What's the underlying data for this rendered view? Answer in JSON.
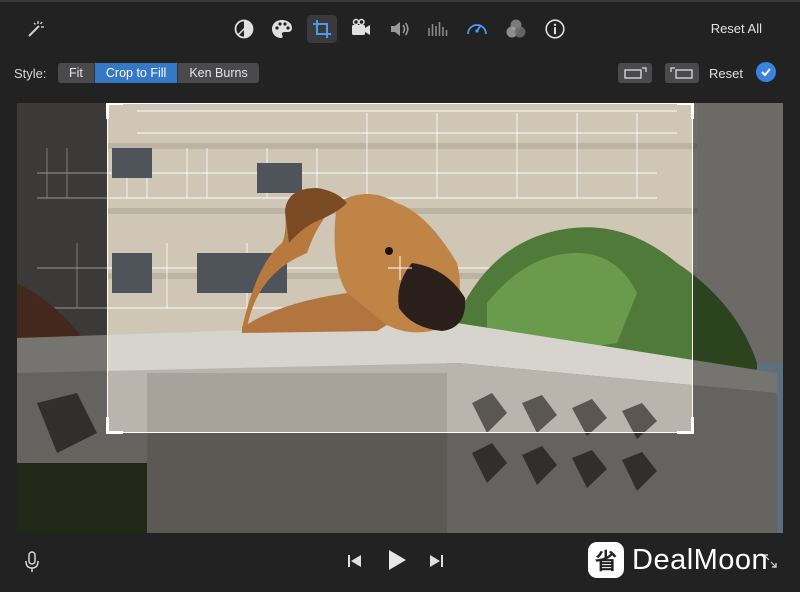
{
  "toolbar": {
    "icons": [
      "magic-wand-icon",
      "color-balance-icon",
      "color-palette-icon",
      "crop-icon",
      "stabilization-icon",
      "volume-icon",
      "equalizer-icon",
      "speed-icon",
      "filter-icon",
      "info-icon"
    ],
    "reset_all_label": "Reset All"
  },
  "style_bar": {
    "label": "Style:",
    "options": [
      "Fit",
      "Crop to Fill",
      "Ken Burns"
    ],
    "selected": "Crop to Fill",
    "reset_label": "Reset"
  },
  "playback": {
    "icons": [
      "microphone-icon",
      "skip-back-icon",
      "play-icon",
      "skip-forward-icon",
      "fullscreen-icon"
    ]
  },
  "watermark": {
    "logo_glyph": "省",
    "text": "DealMoon"
  },
  "colors": {
    "accent": "#3478c6",
    "apply_button": "#3b82e0",
    "background": "#222223"
  }
}
